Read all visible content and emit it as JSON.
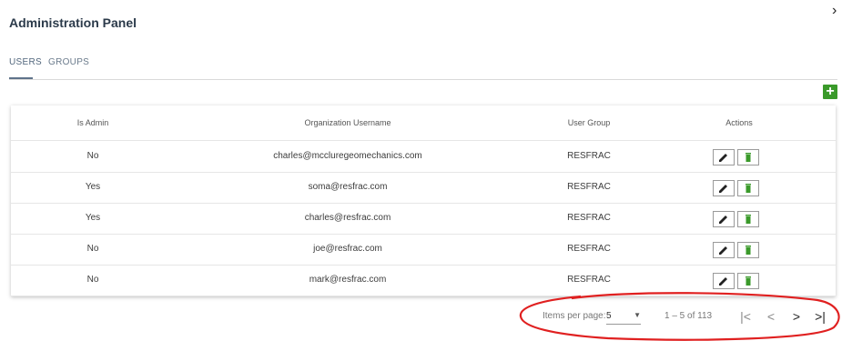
{
  "header": {
    "title": "Administration Panel",
    "close_glyph": "›"
  },
  "tabs": [
    {
      "label": "USERS",
      "active": true
    },
    {
      "label": "GROUPS",
      "active": false
    }
  ],
  "toolbar": {
    "add_label": "+",
    "add_icon": "plus-icon"
  },
  "table": {
    "columns": [
      "Is Admin",
      "Organization Username",
      "User Group",
      "Actions"
    ],
    "rows": [
      {
        "is_admin": "No",
        "username": "charles@mccluregeomechanics.com",
        "group": "RESFRAC"
      },
      {
        "is_admin": "Yes",
        "username": "soma@resfrac.com",
        "group": "RESFRAC"
      },
      {
        "is_admin": "Yes",
        "username": "charles@resfrac.com",
        "group": "RESFRAC"
      },
      {
        "is_admin": "No",
        "username": "joe@resfrac.com",
        "group": "RESFRAC"
      },
      {
        "is_admin": "No",
        "username": "mark@resfrac.com",
        "group": "RESFRAC"
      }
    ],
    "actions": {
      "edit_icon": "pencil-icon",
      "delete_icon": "trash-icon",
      "edit_color": "#222222",
      "delete_color": "#3a9a2a"
    }
  },
  "paginator": {
    "label": "Items per page:",
    "page_size": "5",
    "range": "1 – 5 of 113",
    "first_glyph": "|<",
    "prev_glyph": "<",
    "next_glyph": ">",
    "last_glyph": ">|"
  },
  "colors": {
    "accent_green": "#3a9a2a",
    "annotation_red": "#e02020",
    "tab_active": "#52677d"
  }
}
